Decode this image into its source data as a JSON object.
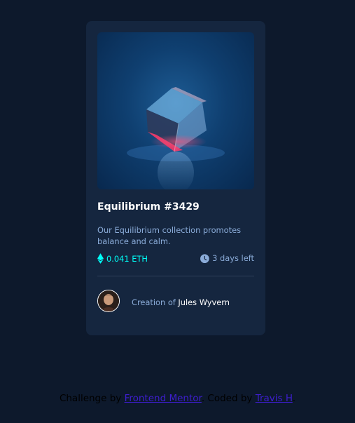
{
  "card": {
    "title": "Equilibrium #3429",
    "description": "Our Equilibrium collection promotes balance and calm.",
    "price": "0.041 ETH",
    "time_left": "3 days left",
    "creation_prefix": "Creation of",
    "creator_name": "Jules Wyvern"
  },
  "attribution": {
    "challenge_prefix": "Challenge by",
    "frontend_mentor": "Frontend Mentor",
    "coded_by": ". Coded by",
    "author": "Travis H",
    "suffix": "."
  },
  "icons": {
    "eth": "ethereum-icon",
    "clock": "clock-icon"
  },
  "colors": {
    "background": "#0d192c",
    "card": "#15263f",
    "cyan": "#00fff8",
    "soft_blue": "#8bacd9",
    "white": "#ffffff",
    "link": "#3e1ecf"
  }
}
